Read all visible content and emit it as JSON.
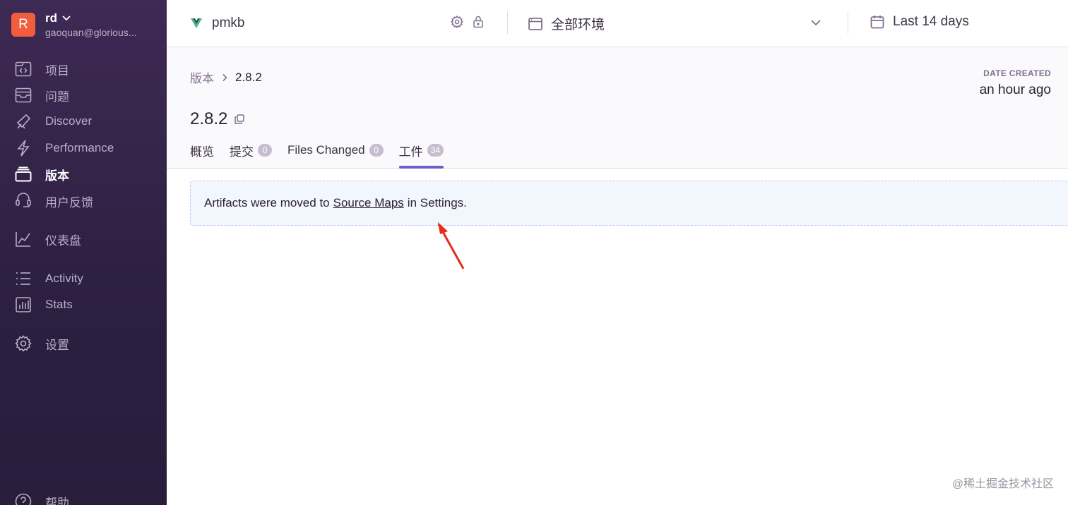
{
  "sidebar": {
    "org": {
      "initial": "R",
      "name": "rd",
      "email": "gaoquan@glorious..."
    },
    "items": [
      {
        "label": "项目",
        "icon": "projects-icon"
      },
      {
        "label": "问题",
        "icon": "issues-icon"
      },
      {
        "label": "Discover",
        "icon": "telescope-icon"
      },
      {
        "label": "Performance",
        "icon": "lightning-icon"
      },
      {
        "label": "版本",
        "icon": "releases-icon",
        "active": true
      },
      {
        "label": "用户反馈",
        "icon": "support-icon"
      },
      {
        "label": "仪表盘",
        "icon": "graph-icon"
      },
      {
        "label": "Activity",
        "icon": "list-icon"
      },
      {
        "label": "Stats",
        "icon": "stats-icon"
      },
      {
        "label": "设置",
        "icon": "gear-icon"
      },
      {
        "label": "帮助",
        "icon": "help-icon"
      }
    ]
  },
  "topbar": {
    "project": "pmkb",
    "environment": "全部环境",
    "date_range": "Last 14 days"
  },
  "page": {
    "breadcrumb": {
      "parent": "版本",
      "current": "2.8.2"
    },
    "date_created_label": "DATE CREATED",
    "date_created_value": "an hour ago",
    "title": "2.8.2",
    "tabs": [
      {
        "label": "概览"
      },
      {
        "label": "提交",
        "badge": "0"
      },
      {
        "label": "Files Changed",
        "badge": "0"
      },
      {
        "label": "工件",
        "badge": "34",
        "active": true
      }
    ]
  },
  "alert": {
    "prefix": "Artifacts were moved to",
    "link": "Source Maps",
    "suffix": "in Settings."
  },
  "colors": {
    "accent": "#6c5fc7",
    "org_avatar": "#f25e3d",
    "arrow": "#e8291c"
  },
  "watermark": "@稀土掘金技术社区"
}
